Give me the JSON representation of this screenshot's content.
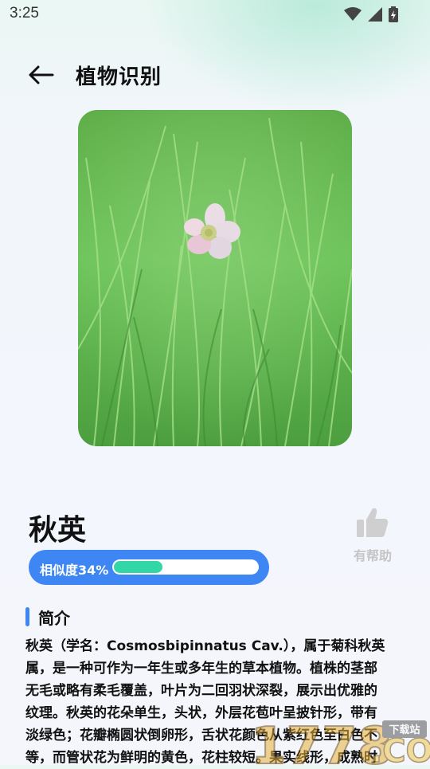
{
  "status_bar": {
    "time": "3:25"
  },
  "header": {
    "title": "植物识别"
  },
  "plant": {
    "name": "秋英"
  },
  "helpful": {
    "label": "有帮助"
  },
  "similarity": {
    "label": "相似度34%",
    "fraction": 0.34
  },
  "intro": {
    "title": "简介",
    "lines": [
      "秋英（学名：Cosmosbipinnatus Cav.），属于菊科秋英",
      "属，是一种可作为一年生或多年生的草本植物。植株的茎部",
      "无毛或略有柔毛覆盖，叶片为二回羽状深裂，展示出优雅的",
      "纹理。秋英的花朵单生，头状，外层花苞叶呈披针形，带有",
      "淡绿色；花瓣椭圆状倒卵形，舌状花颜色从紫红色至白色不",
      "等，而管状花为鲜明的黄色，花柱较短。果实线形，成熟时"
    ]
  },
  "watermark": {
    "site": "1778",
    "label": "下载站"
  }
}
